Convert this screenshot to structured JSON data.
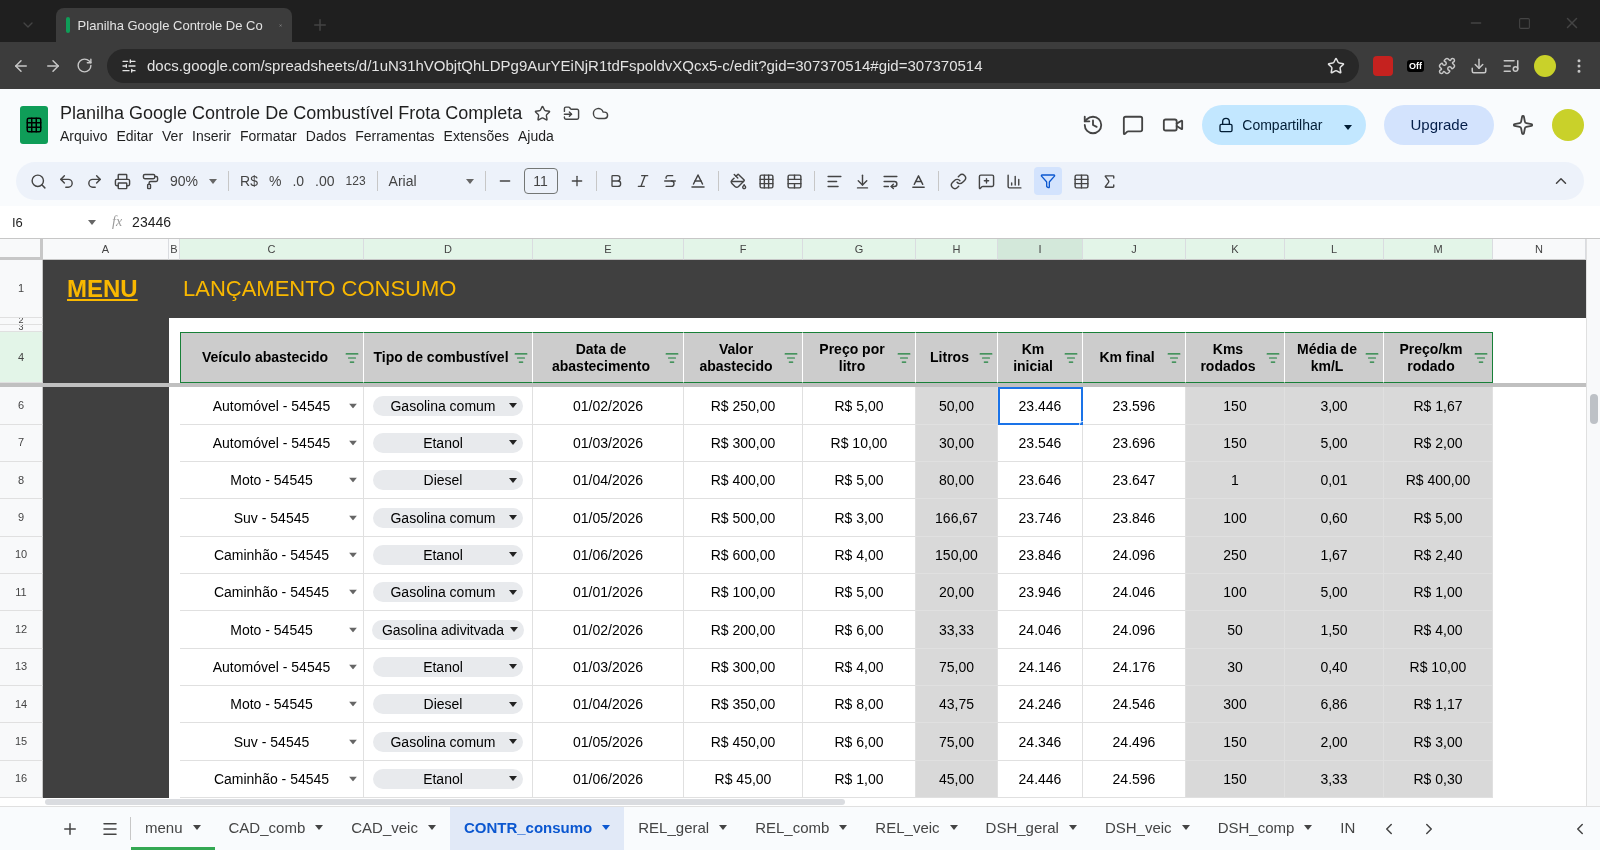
{
  "browser": {
    "tab_title": "Planilha Google Controle De Co",
    "url": "docs.google.com/spreadsheets/d/1uN31hVObjtQhLDPg9AurYEiNjR1tdFspoldvXQcx5-c/edit?gid=307370514#gid=307370514",
    "extension_badge": "Off"
  },
  "document": {
    "title": "Planilha Google Controle De Combustível Frota Completa",
    "menu": [
      "Arquivo",
      "Editar",
      "Ver",
      "Inserir",
      "Formatar",
      "Dados",
      "Ferramentas",
      "Extensões",
      "Ajuda"
    ],
    "share_button": "Compartilhar",
    "upgrade_button": "Upgrade"
  },
  "toolbar": {
    "zoom": "90%",
    "currency": "R$",
    "percent": "%",
    "decrease_decimal": ".0",
    "increase_decimal": ".00",
    "number_format": "123",
    "font": "Arial",
    "font_size": "11"
  },
  "formula_bar": {
    "cell": "I6",
    "fx_label": "fx",
    "value": "23446"
  },
  "sheet": {
    "column_letters": [
      {
        "letter": "A",
        "highlighted": false,
        "selected": false
      },
      {
        "letter": "B",
        "highlighted": false,
        "selected": false
      },
      {
        "letter": "C",
        "highlighted": true,
        "selected": false
      },
      {
        "letter": "D",
        "highlighted": true,
        "selected": false
      },
      {
        "letter": "E",
        "highlighted": true,
        "selected": false
      },
      {
        "letter": "F",
        "highlighted": true,
        "selected": false
      },
      {
        "letter": "G",
        "highlighted": true,
        "selected": false
      },
      {
        "letter": "H",
        "highlighted": true,
        "selected": false
      },
      {
        "letter": "I",
        "highlighted": true,
        "selected": true
      },
      {
        "letter": "J",
        "highlighted": true,
        "selected": false
      },
      {
        "letter": "K",
        "highlighted": true,
        "selected": false
      },
      {
        "letter": "L",
        "highlighted": true,
        "selected": false
      },
      {
        "letter": "M",
        "highlighted": true,
        "selected": false
      },
      {
        "letter": "N",
        "highlighted": false,
        "selected": false
      }
    ],
    "top_rows": [
      {
        "number": "1",
        "highlighted": false
      },
      {
        "number": "2",
        "highlighted": false
      },
      {
        "number": "3",
        "highlighted": false
      },
      {
        "number": "4",
        "highlighted": true
      }
    ],
    "menu_link": "MENU",
    "title": "LANÇAMENTO CONSUMO",
    "headers": [
      {
        "label": "Veículo abastecido",
        "kind": "dropdown"
      },
      {
        "label": "Tipo de combustível",
        "kind": "chip"
      },
      {
        "label": "Data de abastecimento",
        "kind": "text"
      },
      {
        "label": "Valor abastecido",
        "kind": "text"
      },
      {
        "label": "Preço por litro",
        "kind": "text"
      },
      {
        "label": "Litros",
        "kind": "computed"
      },
      {
        "label": "Km inicial",
        "kind": "text"
      },
      {
        "label": "Km final",
        "kind": "text"
      },
      {
        "label": "Kms rodados",
        "kind": "computed"
      },
      {
        "label": "Média de km/L",
        "kind": "computed"
      },
      {
        "label": "Preço/km rodado",
        "kind": "computed"
      }
    ],
    "rows": [
      {
        "number": "6",
        "selected": true,
        "cells": [
          "Automóvel - 54545",
          "Gasolina comum",
          "01/02/2026",
          "R$ 250,00",
          "R$ 5,00",
          "50,00",
          "23.446",
          "23.596",
          "150",
          "3,00",
          "R$ 1,67"
        ]
      },
      {
        "number": "7",
        "selected": false,
        "cells": [
          "Automóvel - 54545",
          "Etanol",
          "01/03/2026",
          "R$ 300,00",
          "R$ 10,00",
          "30,00",
          "23.546",
          "23.696",
          "150",
          "5,00",
          "R$ 2,00"
        ]
      },
      {
        "number": "8",
        "selected": false,
        "cells": [
          "Moto - 54545",
          "Diesel",
          "01/04/2026",
          "R$ 400,00",
          "R$ 5,00",
          "80,00",
          "23.646",
          "23.647",
          "1",
          "0,01",
          "R$ 400,00"
        ]
      },
      {
        "number": "9",
        "selected": false,
        "cells": [
          "Suv - 54545",
          "Gasolina comum",
          "01/05/2026",
          "R$ 500,00",
          "R$ 3,00",
          "166,67",
          "23.746",
          "23.846",
          "100",
          "0,60",
          "R$ 5,00"
        ]
      },
      {
        "number": "10",
        "selected": false,
        "cells": [
          "Caminhão - 54545",
          "Etanol",
          "01/06/2026",
          "R$ 600,00",
          "R$ 4,00",
          "150,00",
          "23.846",
          "24.096",
          "250",
          "1,67",
          "R$ 2,40"
        ]
      },
      {
        "number": "11",
        "selected": false,
        "cells": [
          "Caminhão - 54545",
          "Gasolina comum",
          "01/01/2026",
          "R$ 100,00",
          "R$ 5,00",
          "20,00",
          "23.946",
          "24.046",
          "100",
          "5,00",
          "R$ 1,00"
        ]
      },
      {
        "number": "12",
        "selected": false,
        "cells": [
          "Moto - 54545",
          "Gasolina adivitvada",
          "01/02/2026",
          "R$ 200,00",
          "R$ 6,00",
          "33,33",
          "24.046",
          "24.096",
          "50",
          "1,50",
          "R$ 4,00"
        ]
      },
      {
        "number": "13",
        "selected": false,
        "cells": [
          "Automóvel - 54545",
          "Etanol",
          "01/03/2026",
          "R$ 300,00",
          "R$ 4,00",
          "75,00",
          "24.146",
          "24.176",
          "30",
          "0,40",
          "R$ 10,00"
        ]
      },
      {
        "number": "14",
        "selected": false,
        "cells": [
          "Moto - 54545",
          "Diesel",
          "01/04/2026",
          "R$ 350,00",
          "R$ 8,00",
          "43,75",
          "24.246",
          "24.546",
          "300",
          "6,86",
          "R$ 1,17"
        ]
      },
      {
        "number": "15",
        "selected": false,
        "cells": [
          "Suv - 54545",
          "Gasolina comum",
          "01/05/2026",
          "R$ 450,00",
          "R$ 6,00",
          "75,00",
          "24.346",
          "24.496",
          "150",
          "2,00",
          "R$ 3,00"
        ]
      },
      {
        "number": "16",
        "selected": false,
        "cells": [
          "Caminhão - 54545",
          "Etanol",
          "01/06/2026",
          "R$ 45,00",
          "R$ 1,00",
          "45,00",
          "24.446",
          "24.596",
          "150",
          "3,33",
          "R$ 0,30"
        ]
      }
    ]
  },
  "sheet_tabs": [
    {
      "label": "menu",
      "selected": false,
      "color": "#34a853"
    },
    {
      "label": "CAD_comb",
      "selected": false
    },
    {
      "label": "CAD_veic",
      "selected": false
    },
    {
      "label": "CONTR_consumo",
      "selected": true
    },
    {
      "label": "REL_geral",
      "selected": false
    },
    {
      "label": "REL_comb",
      "selected": false
    },
    {
      "label": "REL_veic",
      "selected": false
    },
    {
      "label": "DSH_geral",
      "selected": false
    },
    {
      "label": "DSH_veic",
      "selected": false
    },
    {
      "label": "DSH_comp",
      "selected": false
    },
    {
      "label": "IN",
      "selected": false
    }
  ]
}
